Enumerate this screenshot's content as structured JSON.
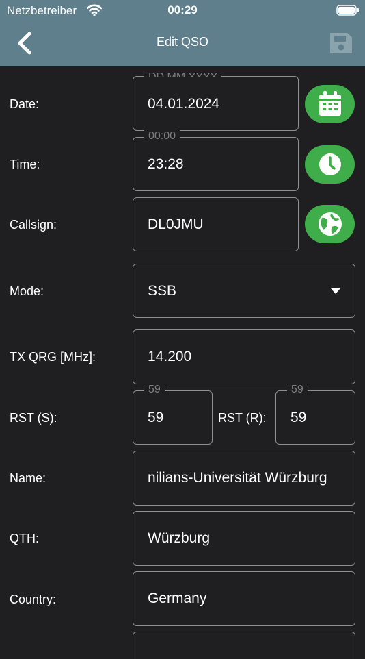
{
  "status_bar": {
    "carrier": "Netzbetreiber",
    "time": "00:29"
  },
  "nav": {
    "title": "Edit QSO"
  },
  "form": {
    "date": {
      "label": "Date:",
      "value": "04.01.2024",
      "hint": "DD.MM.YYYY"
    },
    "time": {
      "label": "Time:",
      "value": "23:28",
      "hint": "00:00"
    },
    "callsign": {
      "label": "Callsign:",
      "value": "DL0JMU"
    },
    "mode": {
      "label": "Mode:",
      "value": "SSB"
    },
    "tx_qrg": {
      "label": "TX QRG [MHz]:",
      "value": "14.200"
    },
    "rst_s": {
      "label": "RST (S):",
      "value": "59",
      "hint": "59"
    },
    "rst_r": {
      "label": "RST (R):",
      "value": "59",
      "hint": "59"
    },
    "name": {
      "label": "Name:",
      "value": "nilians-Universität Würzburg"
    },
    "qth": {
      "label": "QTH:",
      "value": "Würzburg"
    },
    "country": {
      "label": "Country:",
      "value": "Germany"
    }
  },
  "colors": {
    "header": "#5e7f8b",
    "background": "#1f1f22",
    "accent": "#3fad4a"
  },
  "icons": {
    "date_button": "calendar-icon",
    "time_button": "clock-icon",
    "callsign_button": "globe-icon",
    "save": "save-icon",
    "back": "chevron-left-icon"
  }
}
